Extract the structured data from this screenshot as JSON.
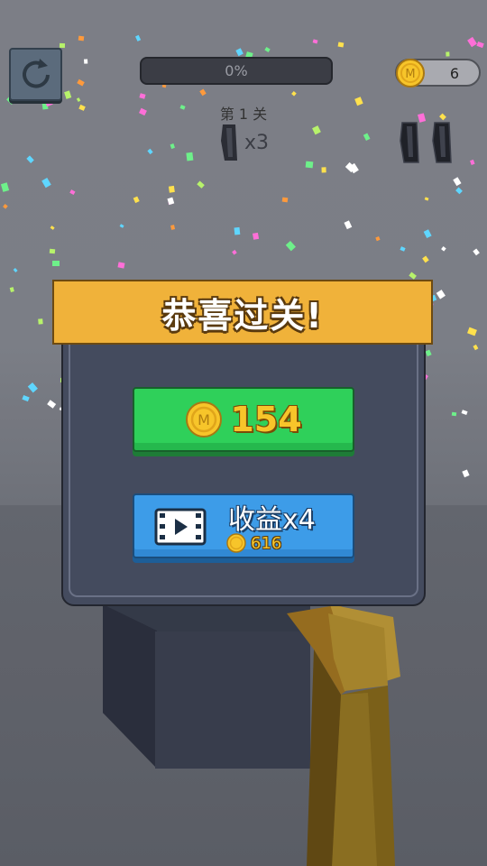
{
  "hud": {
    "progress_text": "0%",
    "progress": 0,
    "coin_count": "6",
    "level_label": "第 1 关",
    "magazine_count": "x3",
    "spare_magazines": 2
  },
  "dialog": {
    "title": "恭喜过关!",
    "reward_amount": "154",
    "ad_button_label": "收益x4",
    "ad_reward_amount": "616"
  },
  "icons": {
    "restart": "restart-icon",
    "coin": "coin-icon",
    "magazine": "magazine-icon",
    "video": "video-icon"
  },
  "colors": {
    "banner": "#f0b23a",
    "panel": "#444b5e",
    "claim_button": "#2fd05a",
    "ad_button": "#3d9ce8",
    "coin_gold": "#f7c52a"
  }
}
